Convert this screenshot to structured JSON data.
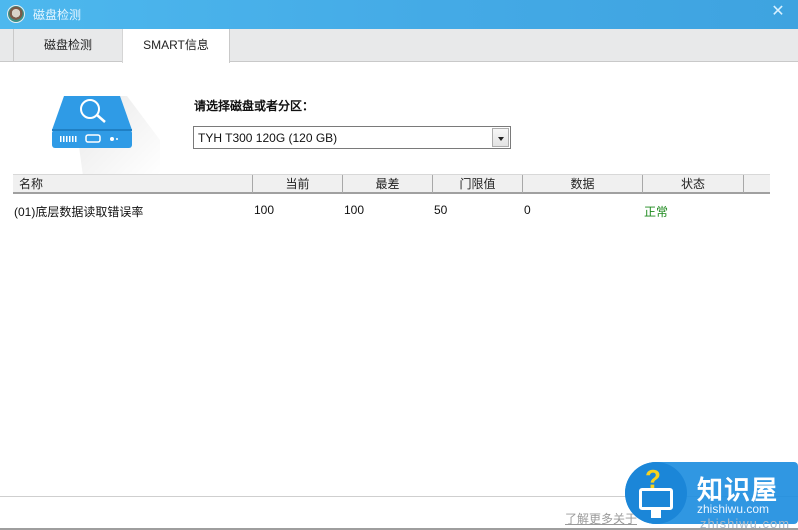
{
  "window": {
    "title": "磁盘检测",
    "close_glyph": "✕"
  },
  "tabs": [
    {
      "label": "磁盘检测",
      "active": false
    },
    {
      "label": "SMART信息",
      "active": true
    }
  ],
  "disk_selector": {
    "label": "请选择磁盘或者分区：",
    "selected": "TYH T300 120G  (120 GB)"
  },
  "table": {
    "columns": [
      "名称",
      "当前",
      "最差",
      "门限值",
      "数据",
      "状态"
    ],
    "rows": [
      {
        "name": "(01)底层数据读取错误率",
        "current": "100",
        "worst": "100",
        "threshold": "50",
        "data": "0",
        "status": "正常"
      }
    ]
  },
  "colors": {
    "titlebar": "#44aae6",
    "status_ok": "#1d8a1d",
    "accent": "#2f9be6"
  },
  "footer": {
    "link_text": "了解更多关于"
  },
  "watermark": {
    "name": "知识屋",
    "domain": "zhishiwu.com",
    "domain_overlay": "zhishiwu.com",
    "glyph": "?"
  }
}
